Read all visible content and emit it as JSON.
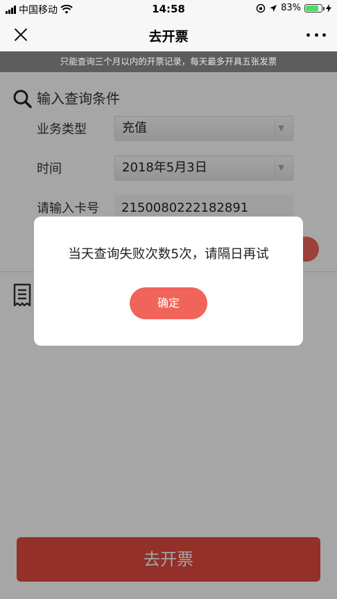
{
  "status_bar": {
    "carrier": "中国移动",
    "time": "14:58",
    "battery_percent": "83%",
    "battery_level": 0.83
  },
  "nav": {
    "title": "去开票"
  },
  "notice": "只能查询三个月以内的开票记录，每天最多开具五张发票",
  "form": {
    "section_title": "输入查询条件",
    "business_type_label": "业务类型",
    "business_type_value": "充值",
    "time_label": "时间",
    "time_value": "2018年5月3日",
    "card_label": "请输入卡号",
    "card_value": "2150080222182891"
  },
  "bottom_button": "去开票",
  "dialog": {
    "message": "当天查询失败次数5次，请隔日再试",
    "confirm_label": "确定"
  },
  "colors": {
    "accent": "#f0645a",
    "bottom_button": "#e14b3f",
    "notice_bg": "#5d5d5d"
  }
}
